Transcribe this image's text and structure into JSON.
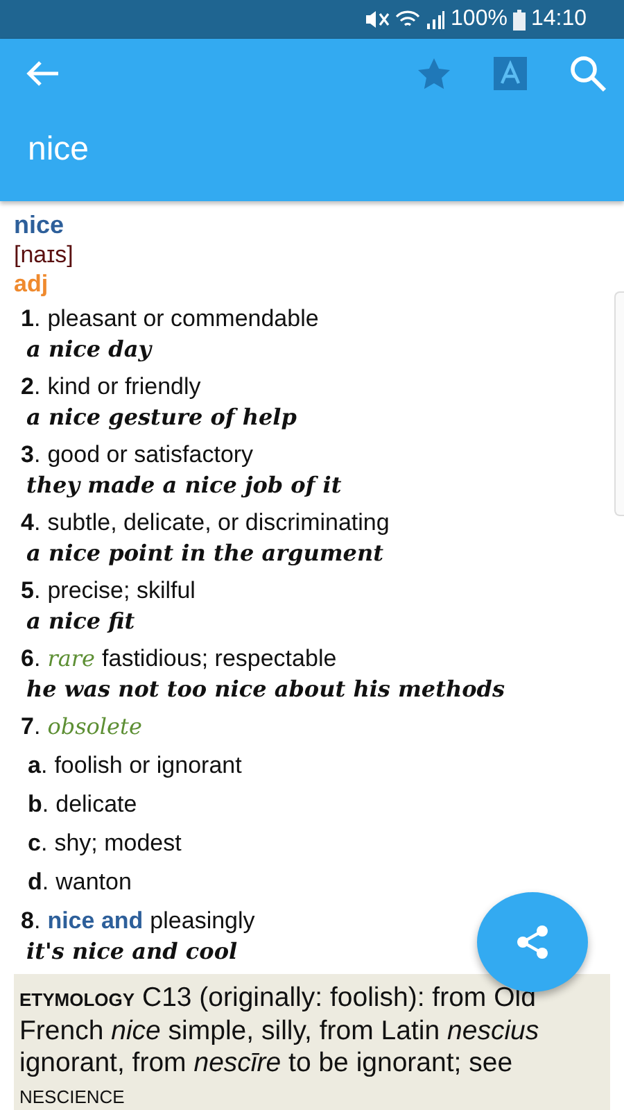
{
  "status_bar": {
    "battery": "100%",
    "time": "14:10"
  },
  "app_bar": {
    "title": "nice"
  },
  "entry": {
    "headword": "nice",
    "pronunciation": "[naɪs]",
    "part_of_speech": "adj",
    "senses": [
      {
        "number": "**1**.",
        "definition": "pleasant or commendable",
        "example": "a nice day"
      },
      {
        "number": "**2**.",
        "definition": "kind or friendly",
        "example": "a nice gesture of help"
      },
      {
        "number": "**3**.",
        "definition": "good or satisfactory",
        "example": "they made a nice job of it"
      },
      {
        "number": "**4**.",
        "definition": "subtle, delicate, or discriminating",
        "example": "a nice point in the argument"
      },
      {
        "number": "**5**.",
        "definition": "precise; skilful",
        "example": "a nice fit"
      },
      {
        "number": "**6**.",
        "label": "rare",
        "definition": "fastidious; respectable",
        "example": "he was not too nice about his methods"
      },
      {
        "number": "**7**.",
        "label": "obsolete",
        "subsenses": [
          {
            "letter": "**a**.",
            "definition": "foolish or ignorant"
          },
          {
            "letter": "**b**.",
            "definition": "delicate"
          },
          {
            "letter": "**c**.",
            "definition": "shy; modest"
          },
          {
            "letter": "**d**.",
            "definition": "wanton"
          }
        ]
      },
      {
        "number": "**8**.",
        "phrase": "nice and",
        "definition": "pleasingly",
        "example": "it's nice and cool"
      }
    ],
    "etymology": {
      "label": "ETYMOLOGY",
      "text": "C13 (originally: foolish): from Old French *nice* simple, silly, from Latin *nescius* ignorant, from *nescīre* to be ignorant; see",
      "cross_reference": "NESCIENCE"
    }
  }
}
